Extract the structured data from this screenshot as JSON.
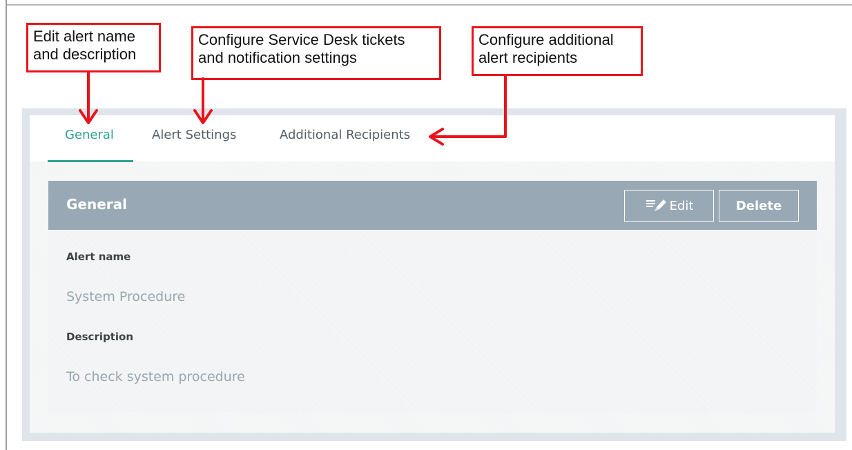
{
  "callouts": {
    "general": "Edit alert name\nand description",
    "alert_settings": "Configure Service Desk tickets\nand notification settings",
    "recipients": "Configure additional\nalert recipients"
  },
  "tabs": [
    {
      "label": "General",
      "active": true
    },
    {
      "label": "Alert Settings",
      "active": false
    },
    {
      "label": "Additional Recipients",
      "active": false
    }
  ],
  "card": {
    "title": "General",
    "edit_label": "Edit",
    "delete_label": "Delete",
    "edit_icon": "pencil-edit-icon"
  },
  "fields": {
    "alert_name_label": "Alert name",
    "alert_name_value": "System Procedure",
    "description_label": "Description",
    "description_value": "To check system procedure"
  },
  "colors": {
    "accent": "#2fa190",
    "callout_border": "#e8141b",
    "header_bg": "#98a8b5"
  }
}
